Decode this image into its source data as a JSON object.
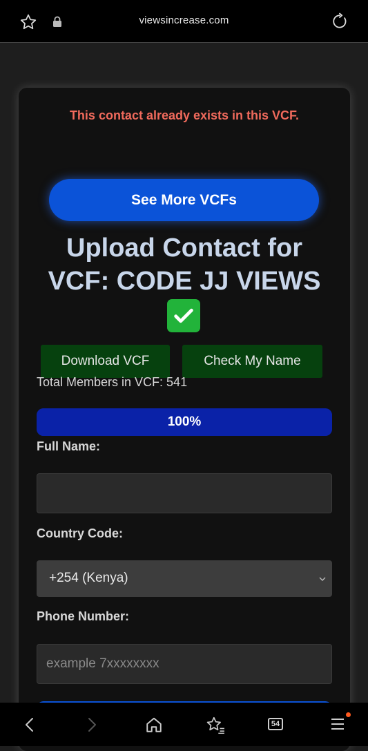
{
  "browser": {
    "url": "viewsincrease.com",
    "tab_count": "54",
    "icons": [
      "star-icon",
      "lock-icon",
      "refresh-icon",
      "back-icon",
      "forward-icon",
      "home-icon",
      "favorites-icon",
      "tabs-icon",
      "menu-icon"
    ],
    "notification_color": "#ff5a1f"
  },
  "page": {
    "error_message": "This contact already exists in this VCF.",
    "see_more_label": "See More VCFs",
    "title_line1": "Upload Contact for",
    "title_line2": "VCF: CODE JJ VIEWS",
    "download_label": "Download VCF",
    "check_name_label": "Check My Name",
    "members_text": "Total Members in VCF: 541",
    "progress_text": "100%",
    "progress_value": 100,
    "full_name_label": "Full Name:",
    "full_name_value": "",
    "country_code_label": "Country Code:",
    "country_code_value": "+254 (Kenya)",
    "phone_label": "Phone Number:",
    "phone_placeholder": "example  7xxxxxxxx",
    "colors": {
      "error": "#f06a5c",
      "primary_button": "#0b53d8",
      "green_button": "#06410e",
      "progress": "#0a22a8"
    }
  }
}
